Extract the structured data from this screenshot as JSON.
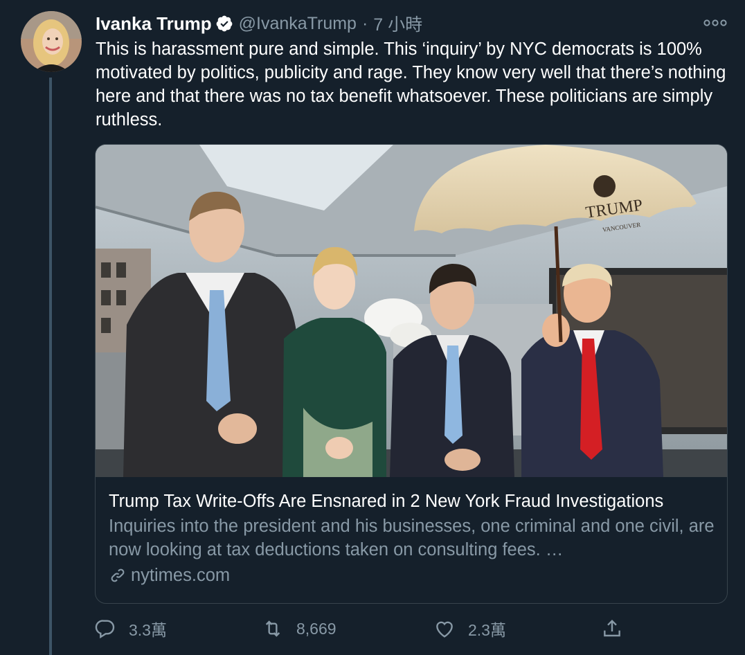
{
  "tweet": {
    "author": {
      "display_name": "Ivanka Trump",
      "handle": "@IvankaTrump",
      "verified": true,
      "avatar_icon": "profile-photo"
    },
    "separator": "·",
    "timestamp": "7 小時",
    "text": "This is harassment pure and simple. This ‘inquiry’ by NYC democrats is 100% motivated by politics, publicity and rage. They know very well that there’s nothing here and that there was no tax benefit whatsoever. These politicians are simply ruthless.",
    "card": {
      "title": "Trump Tax Write-Offs Are Ensnared in 2 New York Fraud Investigations",
      "description": "Inquiries into the president and his businesses, one criminal and one civil, are now looking at tax deductions taken on consulting fees. …",
      "domain": "nytimes.com",
      "umbrella_brand": "TRUMP",
      "umbrella_subtext": "VANCOUVER"
    },
    "actions": {
      "replies": "3.3萬",
      "retweets": "8,669",
      "likes": "2.3萬"
    }
  },
  "colors": {
    "background": "#15202b",
    "secondary_text": "#8899a6",
    "border": "#38444d",
    "verified_badge": "#ffffff"
  }
}
